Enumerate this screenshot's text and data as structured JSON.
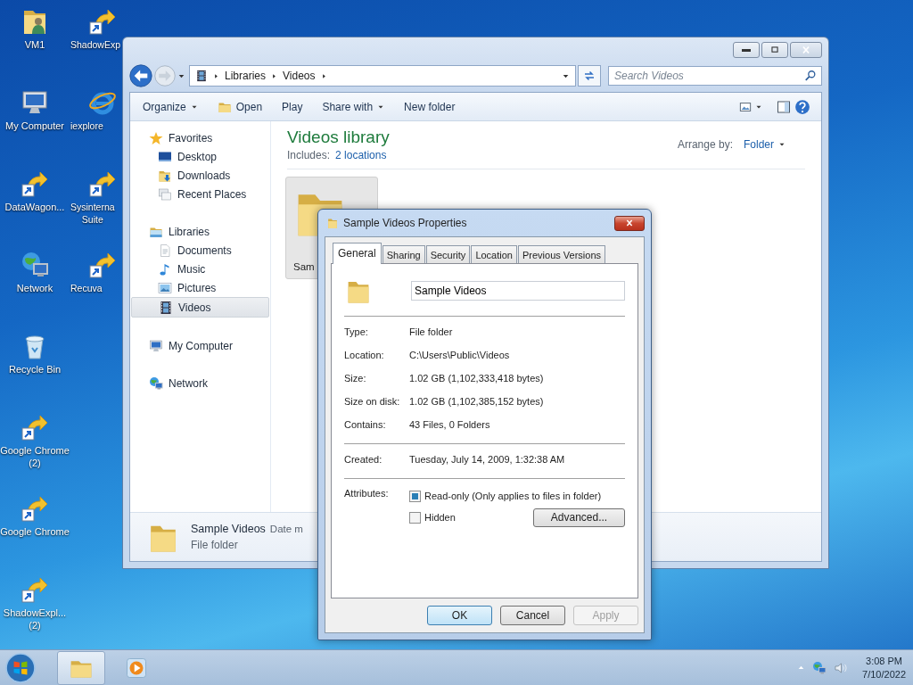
{
  "desktop": {
    "icons": [
      {
        "label": "VM1",
        "kind": "user-folder"
      },
      {
        "label": "My Computer",
        "kind": "computer"
      },
      {
        "label": "DataWagon...",
        "kind": "shortcut"
      },
      {
        "label": "Network",
        "kind": "network"
      },
      {
        "label": "Recycle Bin",
        "kind": "recycle-bin"
      },
      {
        "label": "Google Chrome (2)",
        "kind": "shortcut"
      },
      {
        "label": "Google Chrome",
        "kind": "shortcut"
      },
      {
        "label": "ShadowExpl... (2)",
        "kind": "shortcut"
      },
      {
        "label": "ShadowExp",
        "kind": "shortcut"
      },
      {
        "label": "iexplore",
        "kind": "browser"
      },
      {
        "label": "Sysinterna\nSuite",
        "kind": "shortcut"
      },
      {
        "label": "Recuva",
        "kind": "shortcut"
      }
    ]
  },
  "explorer": {
    "breadcrumbs": [
      "Libraries",
      "Videos"
    ],
    "search": {
      "placeholder": "Search Videos"
    },
    "toolbar": [
      {
        "label": "Organize",
        "kind": "menu"
      },
      {
        "label": "Open",
        "kind": "open"
      },
      {
        "label": "Play",
        "kind": "plain"
      },
      {
        "label": "Share with",
        "kind": "menu"
      },
      {
        "label": "New folder",
        "kind": "plain"
      }
    ],
    "sidebar": [
      {
        "label": "Favorites",
        "kind": "star",
        "selected": false,
        "children": [
          {
            "label": "Desktop",
            "kind": "desktop",
            "selected": false
          },
          {
            "label": "Downloads",
            "kind": "downloads",
            "selected": false
          },
          {
            "label": "Recent Places",
            "kind": "recent",
            "selected": false
          }
        ]
      },
      {
        "label": "Libraries",
        "kind": "library",
        "selected": false,
        "children": [
          {
            "label": "Documents",
            "kind": "document",
            "selected": false
          },
          {
            "label": "Music",
            "kind": "music",
            "selected": false
          },
          {
            "label": "Pictures",
            "kind": "pictures",
            "selected": false
          },
          {
            "label": "Videos",
            "kind": "videos",
            "selected": true
          }
        ]
      },
      {
        "label": "My Computer",
        "kind": "computer",
        "selected": false
      },
      {
        "label": "Network",
        "kind": "network",
        "selected": false
      }
    ],
    "content": {
      "title": "Videos library",
      "includes_label": "Includes:",
      "includes_link": "2 locations",
      "arrange_label": "Arrange by:",
      "arrange_value": "Folder",
      "items": [
        {
          "label": "Sam",
          "selected": true
        }
      ]
    },
    "status": {
      "name": "Sample Videos",
      "detail": "Date m",
      "type": "File folder"
    }
  },
  "dialog": {
    "title": "Sample Videos Properties",
    "tabs": [
      {
        "label": "General",
        "selected": true
      },
      {
        "label": "Sharing",
        "selected": false
      },
      {
        "label": "Security",
        "selected": false
      },
      {
        "label": "Location",
        "selected": false
      },
      {
        "label": "Previous Versions",
        "selected": false
      }
    ],
    "name_value": "Sample Videos",
    "sections": [
      [
        {
          "label": "Type:",
          "value": "File folder"
        },
        {
          "label": "Location:",
          "value": "C:\\Users\\Public\\Videos"
        },
        {
          "label": "Size:",
          "value": "1.02 GB (1,102,333,418 bytes)"
        },
        {
          "label": "Size on disk:",
          "value": "1.02 GB (1,102,385,152 bytes)"
        },
        {
          "label": "Contains:",
          "value": "43 Files, 0 Folders"
        }
      ],
      [
        {
          "label": "Created:",
          "value": "Tuesday, July 14, 2009, 1:32:38 AM"
        }
      ]
    ],
    "attributes_label": "Attributes:",
    "attributes": [
      {
        "label": "Read-only (Only applies to files in folder)",
        "checked": true
      },
      {
        "label": "Hidden",
        "checked": false
      }
    ],
    "advanced": "Advanced...",
    "buttons": [
      {
        "label": "OK",
        "default": true,
        "disabled": false
      },
      {
        "label": "Cancel",
        "default": false,
        "disabled": false
      },
      {
        "label": "Apply",
        "default": false,
        "disabled": true
      }
    ]
  },
  "taskbar": {
    "items": [
      {
        "kind": "explorer",
        "selected": true
      },
      {
        "kind": "media-player",
        "selected": false
      }
    ],
    "time": "3:08 PM",
    "date": "7/10/2022"
  }
}
